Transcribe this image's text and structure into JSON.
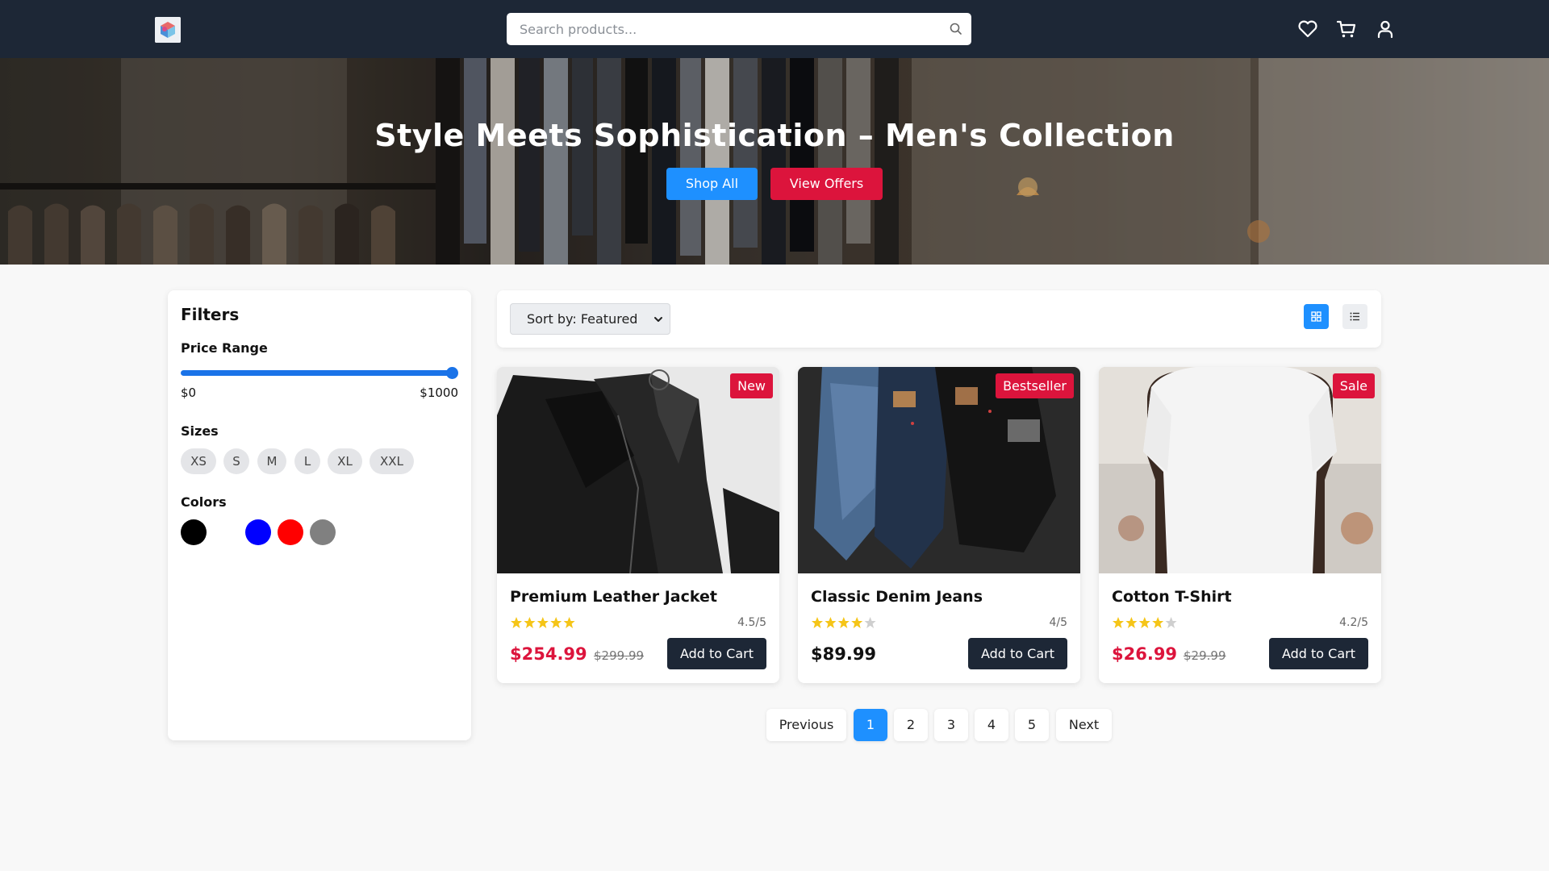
{
  "header": {
    "search_placeholder": "Search products...",
    "icons": [
      "logo-icon",
      "search-icon",
      "heart-icon",
      "cart-icon",
      "user-icon"
    ]
  },
  "hero": {
    "title": "Style Meets Sophistication – Men's Collection",
    "shop_all_label": "Shop All",
    "view_offers_label": "View Offers"
  },
  "filters": {
    "title": "Filters",
    "price_range": {
      "label": "Price Range",
      "min_label": "$0",
      "max_label": "$1000",
      "selected_max_fraction": 1.0
    },
    "sizes": {
      "label": "Sizes",
      "options": [
        "XS",
        "S",
        "M",
        "L",
        "XL",
        "XXL"
      ]
    },
    "colors": {
      "label": "Colors",
      "swatches": [
        "#000000",
        "#ffffff",
        "#0000ff",
        "#ff0000",
        "#808080"
      ]
    }
  },
  "toolbar": {
    "sort_label": "Sort by: Featured",
    "view_mode": "grid",
    "view_icons": [
      "grid-view-icon",
      "list-view-icon"
    ]
  },
  "products": [
    {
      "name": "Premium Leather Jacket",
      "badge": "New",
      "rating_text": "4.5/5",
      "rating": 4.5,
      "price": "$254.99",
      "old_price": "$299.99",
      "add_label": "Add to Cart"
    },
    {
      "name": "Classic Denim Jeans",
      "badge": "Bestseller",
      "rating_text": "4/5",
      "rating": 4,
      "price": "$89.99",
      "old_price": "",
      "add_label": "Add to Cart"
    },
    {
      "name": "Cotton T-Shirt",
      "badge": "Sale",
      "rating_text": "4.2/5",
      "rating": 4.2,
      "price": "$26.99",
      "old_price": "$29.99",
      "add_label": "Add to Cart"
    }
  ],
  "pagination": {
    "previous_label": "Previous",
    "pages": [
      "1",
      "2",
      "3",
      "4",
      "5"
    ],
    "current": "1",
    "next_label": "Next"
  },
  "colors": {
    "nav_bg": "#1d2736",
    "primary_blue": "#1e90ff",
    "accent_red": "#dc143c",
    "star_yellow": "#f5c518"
  }
}
